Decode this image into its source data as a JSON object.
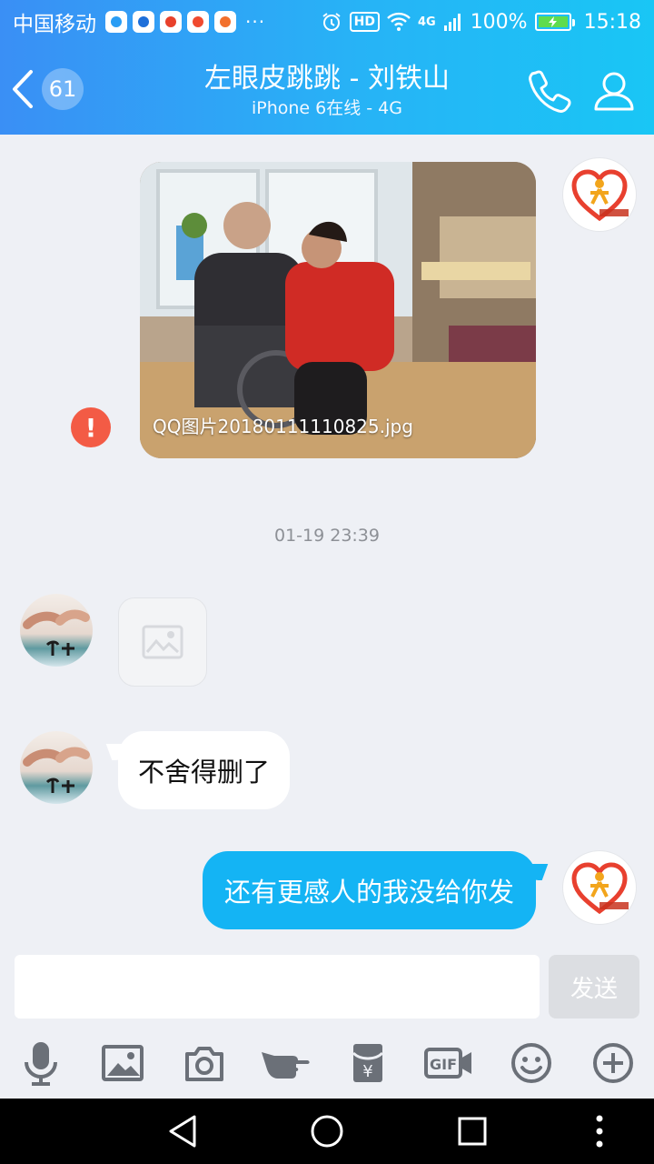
{
  "status_bar": {
    "carrier": "中国移动",
    "more": "···",
    "hd": "HD",
    "network": "4G",
    "battery": "100%",
    "time": "15:18"
  },
  "header": {
    "unread_count": "61",
    "title": "左眼皮跳跳 - 刘铁山",
    "subtitle": "iPhone 6在线 - 4G"
  },
  "messages": {
    "photo_caption": "QQ图片20180111110825.jpg",
    "send_failed_mark": "!",
    "timestamp": "01-19 23:39",
    "friend_text": "不舍得删了",
    "self_text": "还有更感人的我没给你发"
  },
  "input": {
    "value": "",
    "send_label": "发送"
  },
  "toolbar": {
    "icons": [
      "microphone-icon",
      "image-icon",
      "camera-icon",
      "poke-icon",
      "red-packet-icon",
      "gif-icon",
      "emoji-icon",
      "plus-icon"
    ],
    "gif_label": "GIF",
    "red_packet_label": "¥"
  },
  "colors": {
    "header_start": "#3a8ff5",
    "header_end": "#19c6f5",
    "self_bubble": "#14b4f4",
    "fail_badge": "#f35b45",
    "icon_gray": "#6b7078"
  }
}
